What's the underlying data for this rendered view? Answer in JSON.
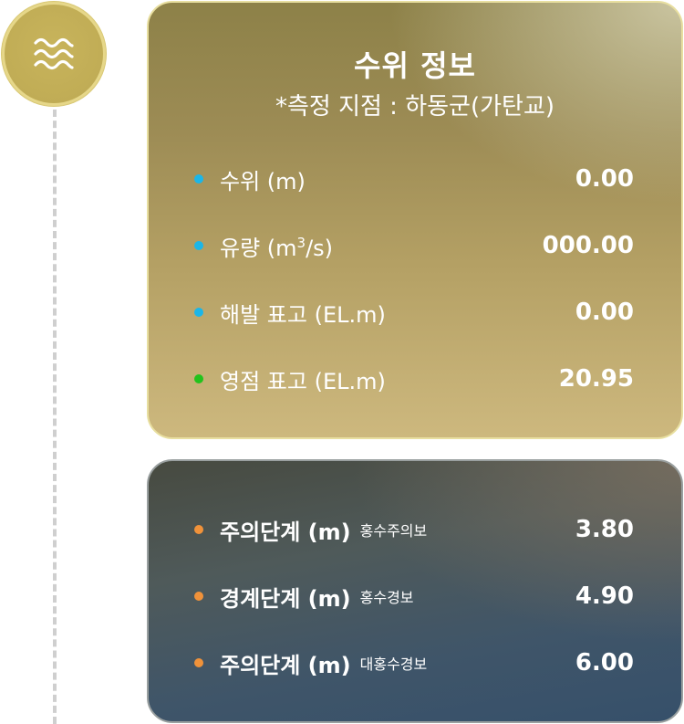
{
  "icon": "water-waves-icon",
  "colors": {
    "accent_gold": "#c4b05a",
    "bullet_blue": "#1bb6e8",
    "bullet_green": "#22c31c",
    "bullet_orange": "#f0923a"
  },
  "info_card": {
    "title": "수위 정보",
    "subtitle": "*측정 지점 : 하동군(가탄교)",
    "rows": [
      {
        "label": "수위 (m)",
        "value": "0.00",
        "bullet": "blue"
      },
      {
        "label_prefix": "유량 (m",
        "label_sup": "3",
        "label_suffix": "/s)",
        "value": "000.00",
        "bullet": "blue"
      },
      {
        "label": "해발 표고 (EL.m)",
        "value": "0.00",
        "bullet": "blue"
      },
      {
        "label": "영점 표고 (EL.m)",
        "value": "20.95",
        "bullet": "green"
      }
    ]
  },
  "alert_card": {
    "rows": [
      {
        "label": "주의단계 (m)",
        "note": "홍수주의보",
        "value": "3.80"
      },
      {
        "label": "경계단계 (m)",
        "note": "홍수경보",
        "value": "4.90"
      },
      {
        "label": "주의단계 (m)",
        "note": "대홍수경보",
        "value": "6.00"
      }
    ]
  }
}
